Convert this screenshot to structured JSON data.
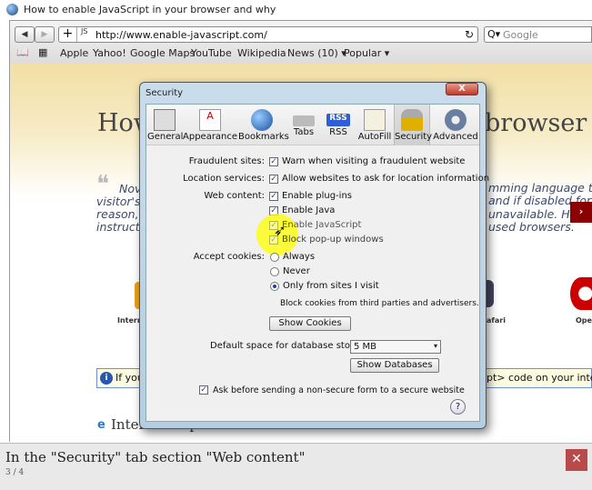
{
  "window": {
    "title": "How to enable JavaScript in your browser and why"
  },
  "toolbar": {
    "back": "◀",
    "forward": "▶",
    "add": "+",
    "js_badge": "JS",
    "url": "http://www.enable-javascript.com/",
    "reload": "↻",
    "search_icon": "Q▾",
    "search_placeholder": "Google"
  },
  "bookmarks": {
    "book_icon": "📖",
    "grid_icon": "▦",
    "items": [
      "Apple",
      "Yahoo!",
      "Google Maps",
      "YouTube",
      "Wikipedia",
      "News (10) ▾",
      "Popular ▾"
    ]
  },
  "page": {
    "heading_left": "How",
    "heading_right": "browser",
    "quote_mark": "❝",
    "quote_left": [
      "Nov",
      "visitor's",
      "reason,",
      "instructi"
    ],
    "quote_right": [
      "mming language tha",
      "and if disabled for s",
      "unavailable. Here",
      "used browsers."
    ],
    "browser_labels": [
      "Intern",
      "afari",
      "Ope"
    ],
    "info_left": "If you",
    "info_right": "pt> code on your intern",
    "section_heading": "Internet Explorer"
  },
  "dialog": {
    "title": "Security",
    "close": "X",
    "tabs": [
      "General",
      "Appearance",
      "Bookmarks",
      "Tabs",
      "RSS",
      "AutoFill",
      "Security",
      "Advanced"
    ],
    "selected_tab": "Security",
    "fraudulent_label": "Fraudulent sites:",
    "fraudulent_opt": "Warn when visiting a fraudulent website",
    "location_label": "Location services:",
    "location_opt": "Allow websites to ask for location information",
    "web_label": "Web content:",
    "web_opts": [
      "Enable plug-ins",
      "Enable Java",
      "Enable JavaScript",
      "Block pop-up windows"
    ],
    "cookies_label": "Accept cookies:",
    "cookie_opts": [
      "Always",
      "Never",
      "Only from sites I visit"
    ],
    "cookie_selected": "Only from sites I visit",
    "cookie_note": "Block cookies from third parties and advertisers.",
    "show_cookies": "Show Cookies",
    "db_label": "Default space for database storage:",
    "db_value": "5 MB",
    "show_databases": "Show Databases",
    "ask_opt": "Ask before sending a non-secure form to a secure website",
    "help": "?"
  },
  "caption": {
    "text": "In the \"Security\" tab section \"Web content\"",
    "counter": "3 / 4",
    "close": "✕"
  },
  "colors": {
    "accent_red": "#8b0000",
    "highlight": "#ffff00",
    "check": "#1b3f9e"
  }
}
